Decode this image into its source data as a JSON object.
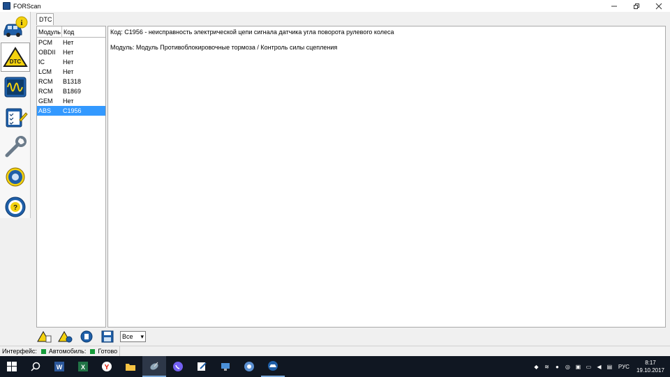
{
  "window": {
    "title": "FORScan"
  },
  "tabs": [
    {
      "label": "DTC"
    }
  ],
  "dtc_list": {
    "headers": {
      "module": "Модуль",
      "code": "Код"
    },
    "rows": [
      {
        "module": "PCM",
        "code": "Нет"
      },
      {
        "module": "OBDII",
        "code": "Нет"
      },
      {
        "module": "IC",
        "code": "Нет"
      },
      {
        "module": "LCM",
        "code": "Нет"
      },
      {
        "module": "RCM",
        "code": "B1318"
      },
      {
        "module": "RCM",
        "code": "B1869"
      },
      {
        "module": "GEM",
        "code": "Нет"
      },
      {
        "module": "ABS",
        "code": "C1956"
      }
    ]
  },
  "detail": {
    "line1": "Код: C1956 - неисправность электрической цепи сигнала датчика угла поворота рулевого колеса",
    "line2": "Модуль: Модуль Противоблокировочные тормоза / Контроль силы сцепления"
  },
  "filter": {
    "selected": "Все"
  },
  "status": {
    "interface_label": "Интерфейс:",
    "vehicle_label": "Автомобиль:",
    "ready_label": "Готово",
    "status_color": "#169c3a"
  },
  "taskbar": {
    "language": "РУС",
    "time": "8:17",
    "date": "19.10.2017"
  }
}
